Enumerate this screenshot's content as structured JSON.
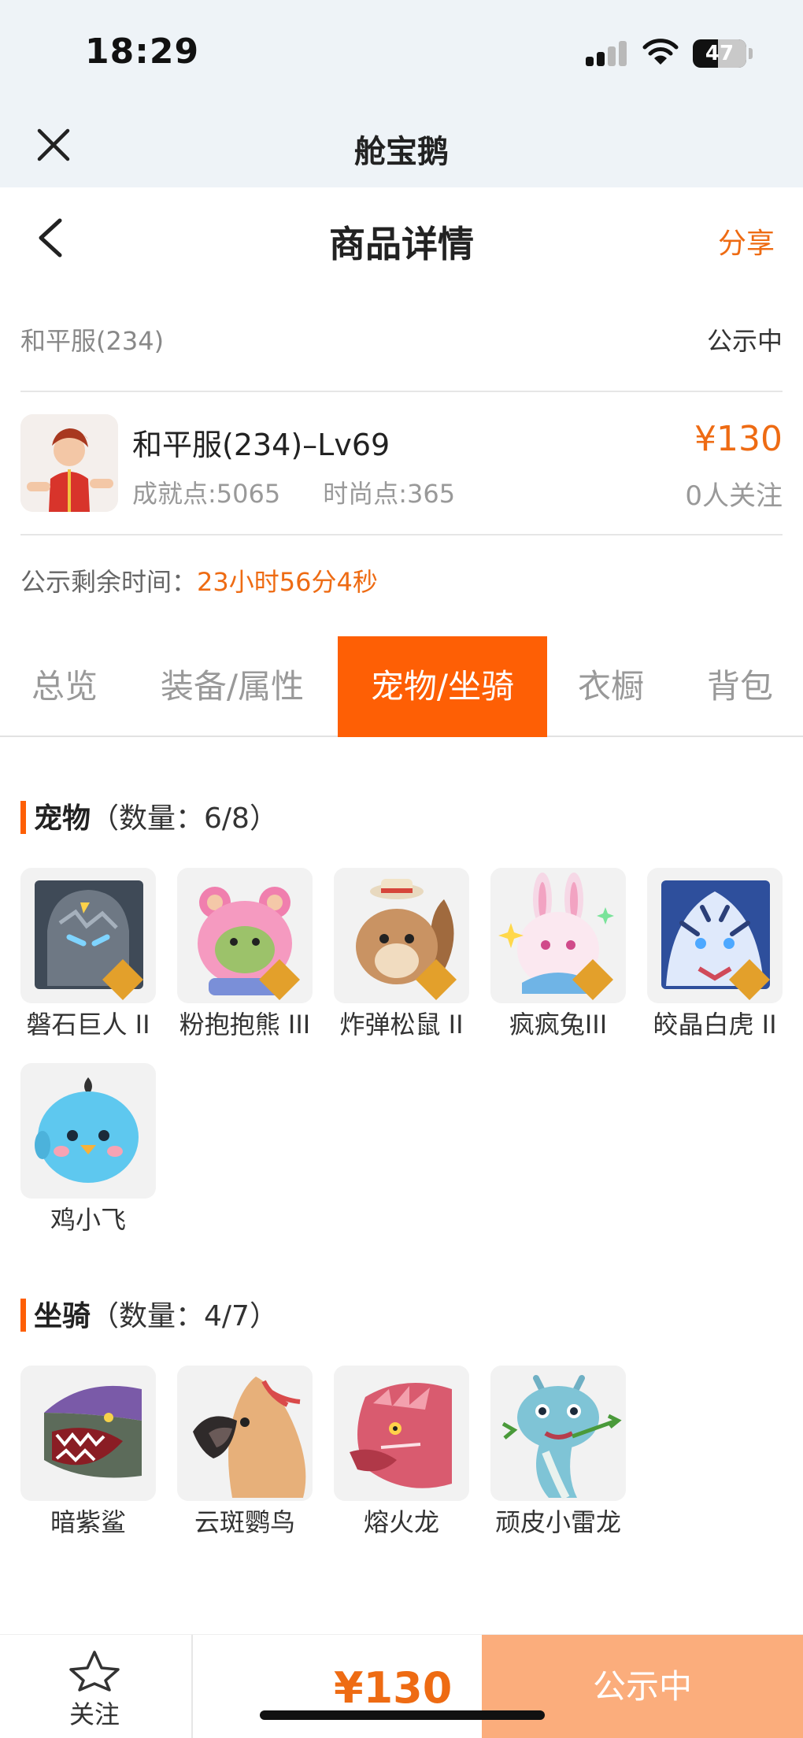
{
  "status_bar": {
    "time": "18:29",
    "battery": "47",
    "battery_level": 0.47
  },
  "app": {
    "title": "舱宝鹅",
    "close_icon": "close-icon"
  },
  "nav": {
    "back_icon": "chevron-left-icon",
    "title": "商品详情",
    "share": "分享"
  },
  "server": {
    "name": "和平服(234)",
    "status": "公示中"
  },
  "product": {
    "name": "和平服(234)–Lv69",
    "achievement": "成就点:5065",
    "fashion": "时尚点:365",
    "price": "¥130",
    "followers": "0人关注"
  },
  "remaining": {
    "label": "公示剩余时间：",
    "value": "23小时56分4秒"
  },
  "tabs": [
    {
      "label": "总览",
      "active": false
    },
    {
      "label": "装备/属性",
      "active": false
    },
    {
      "label": "宠物/坐骑",
      "active": true
    },
    {
      "label": "衣橱",
      "active": false
    },
    {
      "label": "背包",
      "active": false
    }
  ],
  "pets": {
    "title": "宠物",
    "count": "（数量：6/8）",
    "items": [
      {
        "name": "磐石巨人 II",
        "rank": "II",
        "color": "#5b6470"
      },
      {
        "name": "粉抱抱熊 III",
        "rank": "III",
        "color": "#f59ac0"
      },
      {
        "name": "炸弹松鼠 II",
        "rank": "II",
        "color": "#c99363"
      },
      {
        "name": "疯疯兔III",
        "rank": "III",
        "color": "#f6d8e6"
      },
      {
        "name": "皎晶白虎 II",
        "rank": "II",
        "color": "#6f8fd6"
      },
      {
        "name": "鸡小飞",
        "rank": "",
        "color": "#5ec8ef"
      }
    ]
  },
  "mounts": {
    "title": "坐骑",
    "count": "（数量：4/7）",
    "items": [
      {
        "name": "暗紫鲨",
        "color": "#7a5aa8"
      },
      {
        "name": "云斑鹦鸟",
        "color": "#e7b07a"
      },
      {
        "name": "熔火龙",
        "color": "#d95b6f"
      },
      {
        "name": "顽皮小雷龙",
        "color": "#7fc4d6"
      }
    ]
  },
  "bottom": {
    "follow": "关注",
    "price": "¥130",
    "status": "公示中"
  },
  "colors": {
    "accent": "#fe5f05",
    "price": "#ee6b13",
    "status_button": "#fbad7c"
  }
}
